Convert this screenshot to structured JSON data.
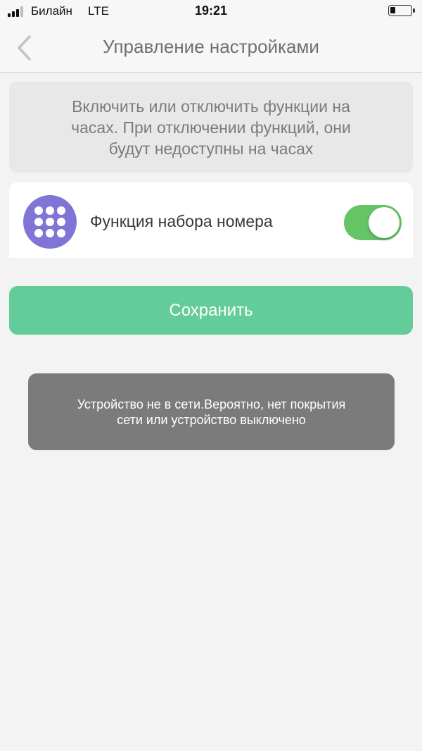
{
  "status_bar": {
    "carrier": "Билайн",
    "network": "LTE",
    "time": "19:21",
    "battery_level": 0.25,
    "signal_bars_active": 3
  },
  "header": {
    "title": "Управление настройками",
    "back_icon": "chevron-left-icon"
  },
  "info": {
    "lines": [
      "Включить или отключить функции на",
      "часах. При отключении функций, они",
      "будут недоступны на часах"
    ]
  },
  "features": [
    {
      "label": "Функция набора номера",
      "icon": "dialpad-icon",
      "enabled": true
    }
  ],
  "save_label": "Сохранить",
  "toast": {
    "lines": [
      "Устройство не в сети.Вероятно, нет покрытия",
      "сети или устройство выключено"
    ]
  },
  "colors": {
    "accent_purple": "#8075d6",
    "toggle_on": "#65c466",
    "save_green": "#63cc98",
    "toast_bg": "#7b7b7b"
  }
}
